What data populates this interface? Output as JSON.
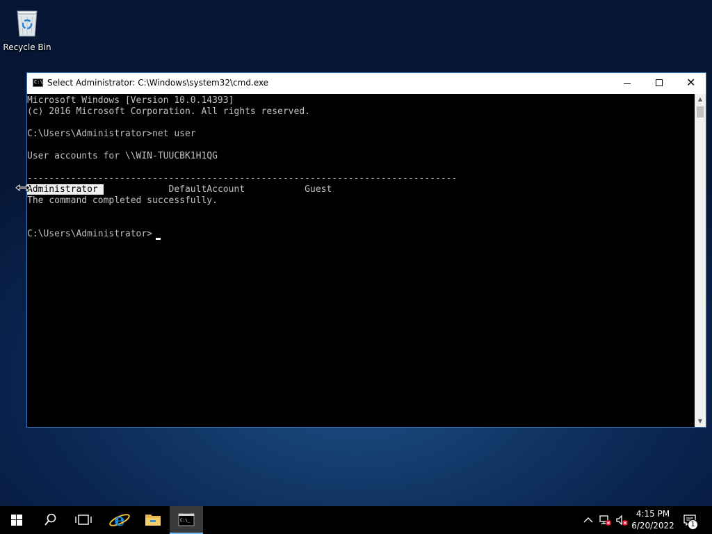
{
  "desktop": {
    "icons": [
      {
        "label": "Recycle Bin",
        "icon": "recycle-bin-icon"
      }
    ]
  },
  "window": {
    "title": "Select Administrator: C:\\Windows\\system32\\cmd.exe",
    "icon": "cmd-icon",
    "controls": [
      "minimize-icon",
      "maximize-icon",
      "close-icon"
    ]
  },
  "console": {
    "lines": [
      "Microsoft Windows [Version 10.0.14393]",
      "(c) 2016 Microsoft Corporation. All rights reserved.",
      "",
      "C:\\Users\\Administrator>net user",
      "",
      "User accounts for \\\\WIN-TUUCBK1H1QG",
      "",
      "-------------------------------------------------------------------------------",
      "",
      "The command completed successfully.",
      "",
      "",
      "C:\\Users\\Administrator>"
    ],
    "accounts": {
      "selected": "Administrator",
      "selection_padding": " ",
      "gap1": "            ",
      "second": "DefaultAccount",
      "gap2": "           ",
      "third": "Guest"
    }
  },
  "taskbar": {
    "items": [
      {
        "name": "start",
        "icon": "windows-logo-icon"
      },
      {
        "name": "search",
        "icon": "search-icon"
      },
      {
        "name": "task-view",
        "icon": "task-view-icon"
      },
      {
        "name": "internet-explorer",
        "icon": "internet-explorer-icon"
      },
      {
        "name": "file-explorer",
        "icon": "folder-icon"
      },
      {
        "name": "command-prompt",
        "icon": "cmd-icon",
        "active": true
      }
    ],
    "tray": {
      "icons": [
        "chevron-up-icon",
        "network-error-icon",
        "volume-muted-icon"
      ],
      "time": "4:15 PM",
      "date": "6/20/2022",
      "notification_count": "1"
    }
  },
  "colors": {
    "console_bg": "#000000",
    "console_fg": "#c0c0c0",
    "selection_bg": "#f0f0f0",
    "taskbar_bg": "#000000",
    "active_task_accent": "#76b9ed",
    "window_border": "#3b78b8"
  }
}
